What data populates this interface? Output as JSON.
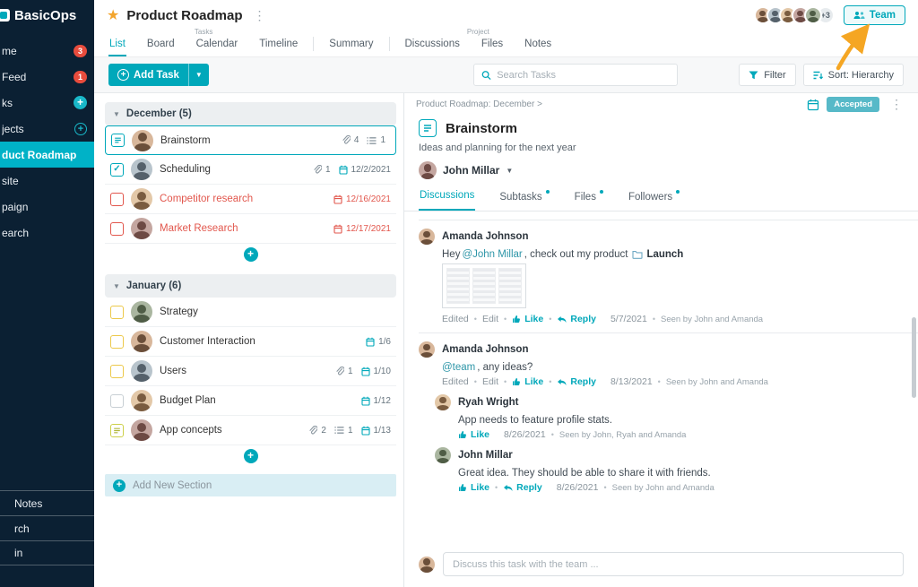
{
  "colors": {
    "accent": "#00a8ba",
    "sidebar_bg": "#0b2033",
    "sidebar_active": "#00b2c7",
    "danger": "#e84c3d",
    "overdue": "#e2574d",
    "warning": "#ecc94b",
    "star": "#f3a52d",
    "arrow": "#f5a623",
    "accepted": "#57b9c8"
  },
  "sidebar": {
    "logo": "BasicOps",
    "items": [
      {
        "label": "me",
        "badge": "3"
      },
      {
        "label": "Feed",
        "badge": "1"
      },
      {
        "label": "ks",
        "action": "plus-filled"
      },
      {
        "label": "jects",
        "action": "plus-outline"
      },
      {
        "label": "duct Roadmap",
        "active": true
      },
      {
        "label": "site"
      },
      {
        "label": "paign"
      },
      {
        "label": "earch"
      }
    ],
    "footer_items": [
      {
        "label": "Notes"
      },
      {
        "label": "rch"
      },
      {
        "label": "in"
      }
    ]
  },
  "header": {
    "title": "Product Roadmap",
    "avatar_count": 5,
    "overflow_badge": "+3",
    "team_button": "Team"
  },
  "nav": {
    "groups": [
      {
        "label": "Tasks",
        "tabs": [
          {
            "label": "List",
            "active": true
          },
          {
            "label": "Board"
          },
          {
            "label": "Calendar"
          },
          {
            "label": "Timeline"
          }
        ]
      },
      {
        "label": "",
        "tabs": [
          {
            "label": "Summary"
          }
        ]
      },
      {
        "label": "Project",
        "tabs": [
          {
            "label": "Discussions"
          },
          {
            "label": "Files"
          },
          {
            "label": "Notes"
          }
        ]
      }
    ]
  },
  "toolbar": {
    "add_task": "Add Task",
    "search_placeholder": "Search Tasks",
    "filter": "Filter",
    "sort": "Sort: Hierarchy"
  },
  "task_list": {
    "sections": [
      {
        "name": "December (5)",
        "tasks": [
          {
            "name": "Brainstorm",
            "selected": true,
            "check": "note-teal",
            "attachments": "4",
            "subtasks": "1"
          },
          {
            "name": "Scheduling",
            "check": "checked-teal",
            "attachments": "1",
            "due": "12/2/2021"
          },
          {
            "name": "Competitor research",
            "check": "empty-red",
            "due": "12/16/2021",
            "overdue": true
          },
          {
            "name": "Market Research",
            "check": "empty-red",
            "due": "12/17/2021",
            "overdue": true
          }
        ]
      },
      {
        "name": "January (6)",
        "tasks": [
          {
            "name": "Strategy",
            "check": "empty-yellow"
          },
          {
            "name": "Customer Interaction",
            "check": "empty-yellow",
            "due": "1/6"
          },
          {
            "name": "Users",
            "check": "empty-yellow",
            "attachments": "1",
            "due": "1/10"
          },
          {
            "name": "Budget Plan",
            "check": "empty-gray",
            "due": "1/12"
          },
          {
            "name": "App concepts",
            "check": "note-yellow",
            "attachments": "2",
            "subtasks": "1",
            "due": "1/13"
          }
        ]
      }
    ],
    "add_new_section": "Add New Section"
  },
  "detail": {
    "breadcrumb": "Product Roadmap: December  >",
    "status": "Accepted",
    "title": "Brainstorm",
    "description": "Ideas and planning for the next year",
    "assignee": "John Millar",
    "tabs": [
      {
        "label": "Discussions",
        "active": true
      },
      {
        "label": "Subtasks",
        "dot": true
      },
      {
        "label": "Files",
        "dot": true
      },
      {
        "label": "Followers",
        "dot": true
      }
    ],
    "meta_labels": {
      "edited": "Edited",
      "edit": "Edit",
      "like": "Like",
      "reply": "Reply"
    },
    "comments": [
      {
        "author": "Amanda Johnson",
        "body": [
          {
            "t": "Hey "
          },
          {
            "t": "@John Millar",
            "s": "mention"
          },
          {
            "t": ", check out my product "
          },
          {
            "t": "Launch",
            "s": "doc"
          }
        ],
        "thumbnail": true,
        "edited": true,
        "can_reply": true,
        "date": "5/7/2021",
        "seen": "Seen by John and Amanda"
      },
      {
        "author": "Amanda Johnson",
        "body": [
          {
            "t": "@team",
            "s": "mention"
          },
          {
            "t": ", any ideas?"
          }
        ],
        "edited": true,
        "can_reply": true,
        "date": "8/13/2021",
        "seen": "Seen by John and Amanda",
        "replies": [
          {
            "author": "Ryah Wright",
            "body": [
              {
                "t": "App needs to feature profile stats."
              }
            ],
            "edited": false,
            "can_reply": false,
            "date": "8/26/2021",
            "seen": "Seen by John, Ryah and Amanda"
          },
          {
            "author": "John Millar",
            "body": [
              {
                "t": "Great idea. They should be able to share it with friends."
              }
            ],
            "edited": false,
            "can_reply": true,
            "date": "8/26/2021",
            "seen": "Seen by John and Amanda"
          }
        ]
      }
    ],
    "composer_placeholder": "Discuss this task with the team ..."
  }
}
